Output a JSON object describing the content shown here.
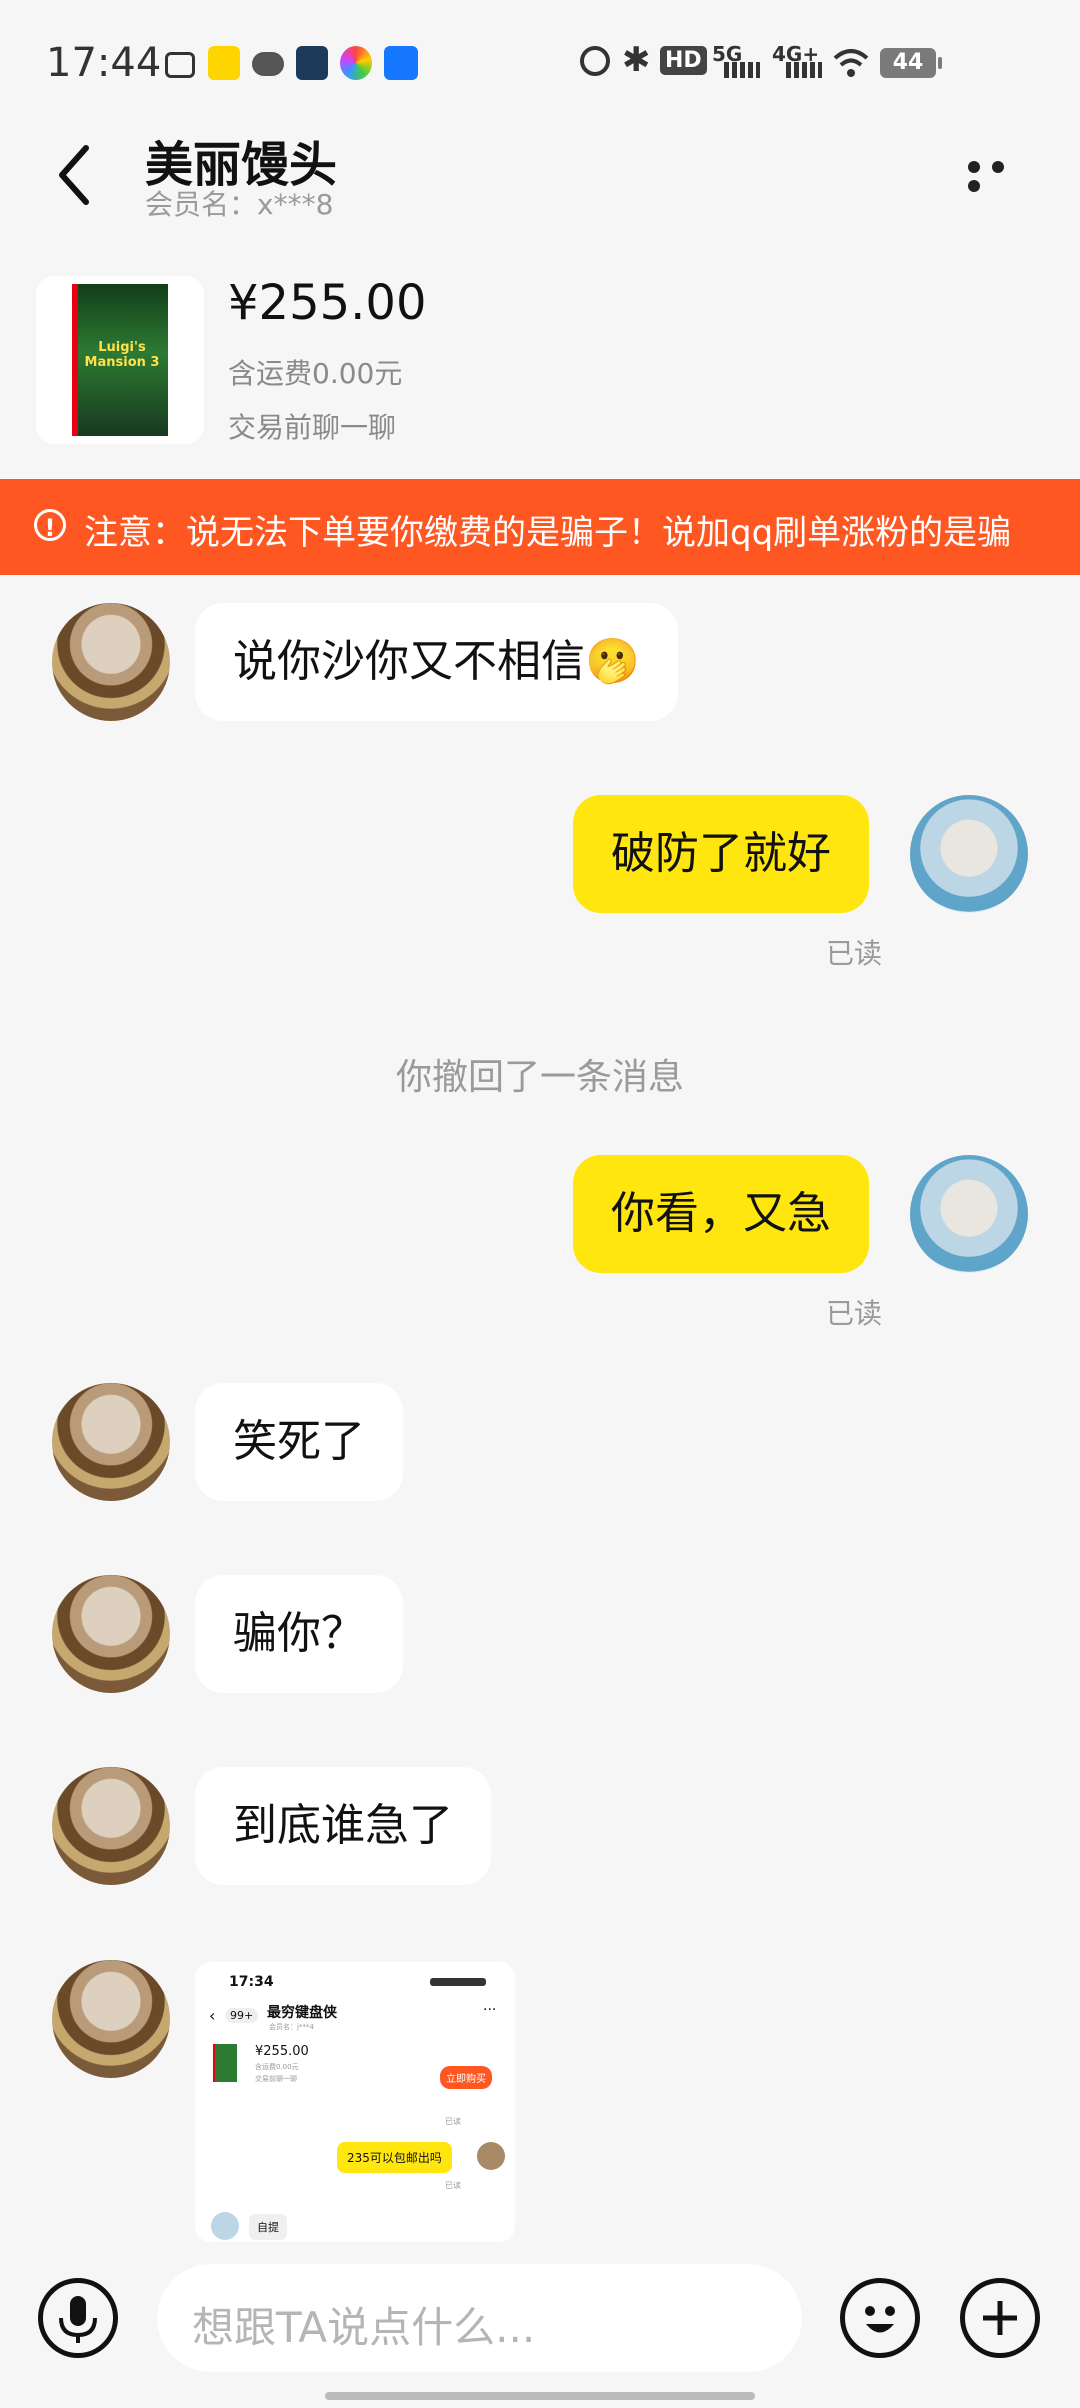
{
  "status_bar": {
    "time": "17:44",
    "signal_5g": "5G",
    "signal_4g": "4G+",
    "hd": "HD",
    "battery": "44"
  },
  "header": {
    "title": "美丽馒头",
    "member": "会员名：x***8",
    "back_icon": "chevron-left-icon",
    "more_icon": "more-horizontal-icon"
  },
  "product": {
    "price": "¥255.00",
    "shipping": "含运费0.00元",
    "note": "交易前聊一聊",
    "cover_text": "Luigi's Mansion 3"
  },
  "warning": {
    "text": "注意：说无法下单要你缴费的是骗子！说加qq刷单涨粉的是骗"
  },
  "messages": [
    {
      "side": "in",
      "text": "说你沙你又不相信",
      "emoji": "🫢"
    },
    {
      "side": "out",
      "text": "破防了就好",
      "status": "已读"
    },
    {
      "side": "system",
      "text": "你撤回了一条消息"
    },
    {
      "side": "out",
      "text": "你看，又急",
      "status": "已读"
    },
    {
      "side": "in",
      "text": "笑死了"
    },
    {
      "side": "in",
      "text": "骗你？"
    },
    {
      "side": "in",
      "text": "到底谁急了"
    }
  ],
  "screenshot_message": {
    "time": "17:34",
    "badge": "99+",
    "title": "最穷键盘侠",
    "member": "会员名：j***4",
    "price": "¥255.00",
    "shipping": "含运费0.00元",
    "note": "交易前聊一聊",
    "buy_button": "立即购买",
    "read1": "已读",
    "bubble": "235可以包邮出吗",
    "read2": "已读",
    "self_pick": "自提"
  },
  "input_bar": {
    "placeholder": "想跟TA说点什么...",
    "mic_icon": "microphone-icon",
    "emoji_icon": "smiley-icon",
    "add_icon": "plus-icon"
  },
  "colors": {
    "accent_yellow": "#ffe60f",
    "warning_orange": "#ff5722",
    "background": "#f6f6f6"
  }
}
